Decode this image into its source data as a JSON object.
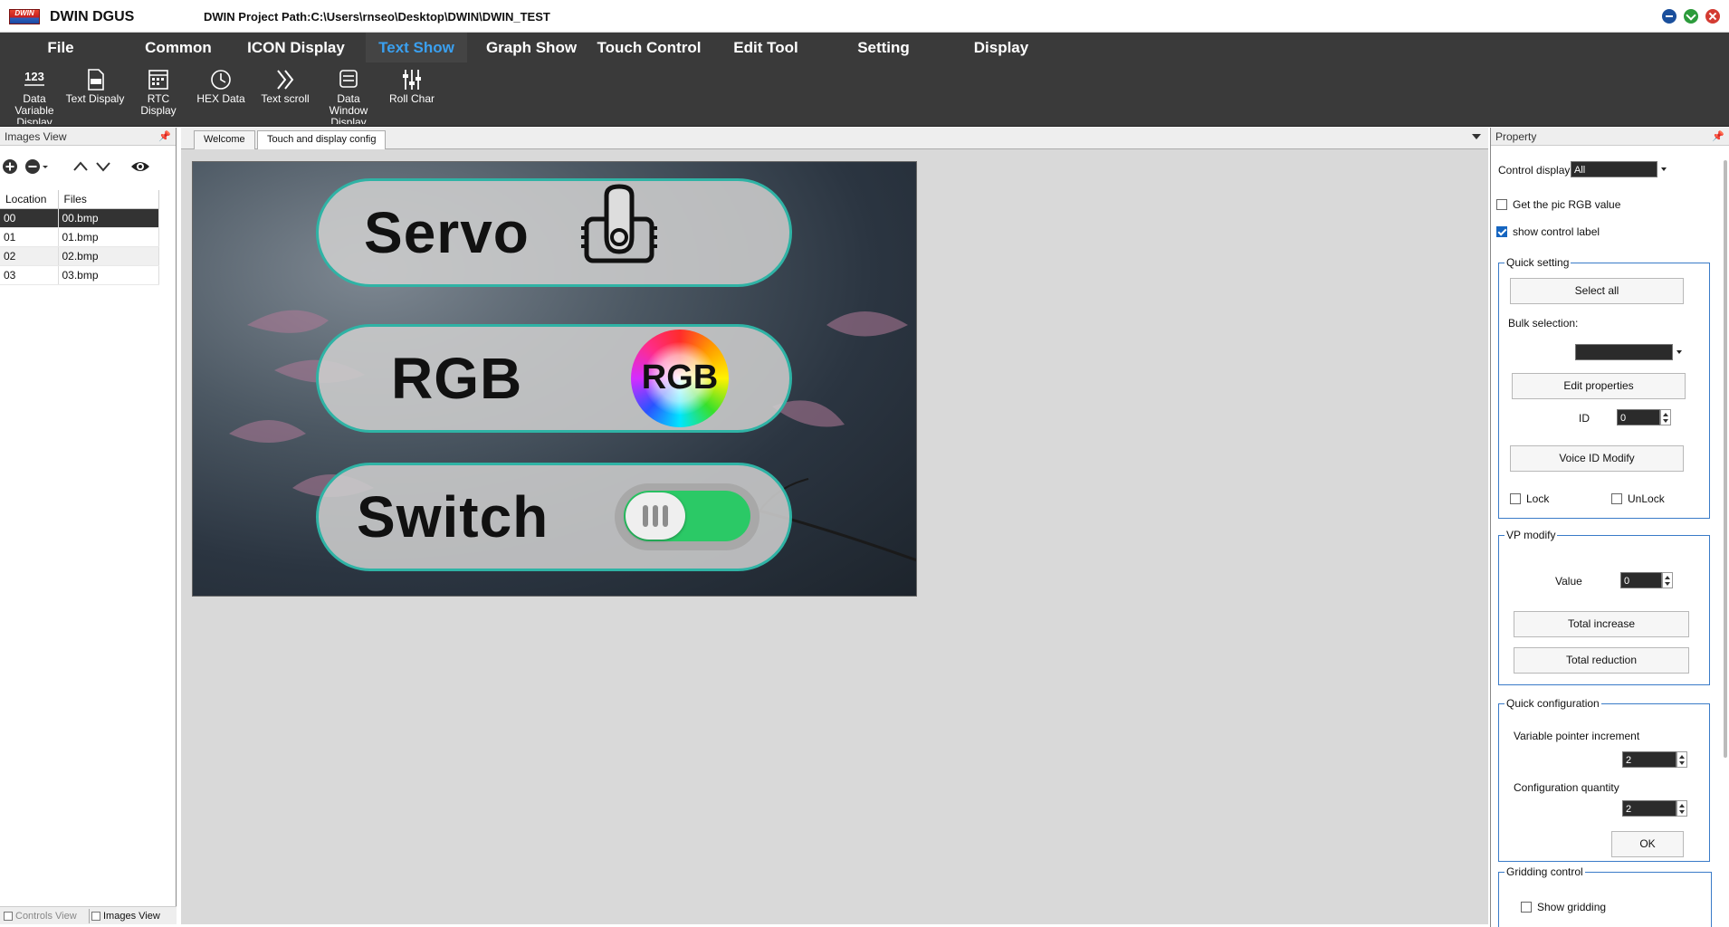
{
  "titlebar": {
    "logo_text": "DWIN",
    "app_title": "DWIN DGUS",
    "project_path": "DWIN Project Path:C:\\Users\\rnseo\\Desktop\\DWIN\\DWIN_TEST"
  },
  "menu": [
    {
      "label": "File"
    },
    {
      "label": "Common"
    },
    {
      "label": "ICON Display"
    },
    {
      "label": "Text Show",
      "active": true
    },
    {
      "label": "Graph Show"
    },
    {
      "label": "Touch Control"
    },
    {
      "label": "Edit Tool"
    },
    {
      "label": "Setting"
    },
    {
      "label": "Display"
    }
  ],
  "ribbon": [
    {
      "label": "Data Variable Display",
      "icon": "number-123-icon"
    },
    {
      "label": "Text Dispaly",
      "icon": "text-document-icon"
    },
    {
      "label": "RTC Display",
      "icon": "calendar-icon"
    },
    {
      "label": "HEX Data",
      "icon": "clock-icon"
    },
    {
      "label": "Text scroll",
      "icon": "double-chevron-right-icon"
    },
    {
      "label": "Data Window Display",
      "icon": "data-window-icon"
    },
    {
      "label": "Roll Char",
      "icon": "sliders-icon"
    }
  ],
  "left_panel": {
    "title": "Images View",
    "columns": [
      "Location",
      "Files"
    ],
    "rows": [
      {
        "location": "00",
        "file": "00.bmp",
        "selected": true
      },
      {
        "location": "01",
        "file": "01.bmp"
      },
      {
        "location": "02",
        "file": "02.bmp"
      },
      {
        "location": "03",
        "file": "03.bmp"
      }
    ],
    "bottom_tabs": [
      "Controls View",
      "Images View"
    ]
  },
  "doc_tabs": [
    "Welcome",
    "Touch and display config"
  ],
  "canvas": {
    "buttons": [
      {
        "label": "Servo",
        "icon": "servo-icon"
      },
      {
        "label": "RGB",
        "icon": "rgb-color-wheel-icon",
        "icon_text": "RGB"
      },
      {
        "label": "Switch",
        "icon": "toggle-switch-icon"
      }
    ]
  },
  "property": {
    "title": "Property",
    "control_display_label": "Control display",
    "control_display_value": "All",
    "get_pic_rgb_label": "Get the pic RGB value",
    "get_pic_rgb_checked": false,
    "show_label_label": "show control label",
    "show_label_checked": true,
    "quick_setting": {
      "title": "Quick setting",
      "select_all": "Select all",
      "bulk_selection": "Bulk selection:",
      "edit_properties": "Edit properties",
      "id_label": "ID",
      "id_value": "0",
      "voice_id_modify": "Voice ID Modify",
      "lock": "Lock",
      "unlock": "UnLock"
    },
    "vp_modify": {
      "title": "VP modify",
      "value_label": "Value",
      "value": "0",
      "total_increase": "Total increase",
      "total_reduction": "Total reduction"
    },
    "quick_config": {
      "title": "Quick configuration",
      "pointer_increment_label": "Variable pointer increment",
      "pointer_increment_value": "2",
      "config_quantity_label": "Configuration quantity",
      "config_quantity_value": "2",
      "ok": "OK"
    },
    "gridding": {
      "title": "Gridding control",
      "show_gridding": "Show gridding"
    }
  }
}
